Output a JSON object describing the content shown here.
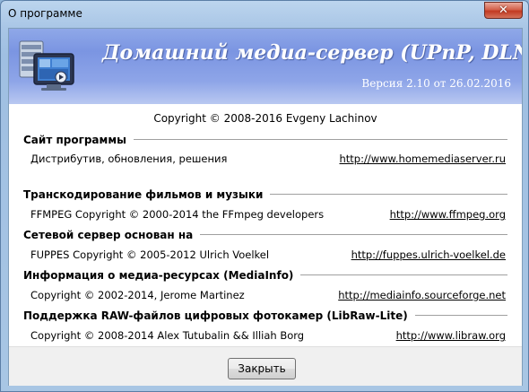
{
  "window": {
    "title": "О программе",
    "close_glyph": "✕"
  },
  "banner": {
    "title": "Домашний медиа-сервер (UPnP, DLNA,",
    "version": "Версия 2.10 от 26.02.2016"
  },
  "copyright": "Copyright © 2008-2016 Evgeny Lachinov",
  "sections": [
    {
      "heading": "Сайт программы",
      "desc": "Дистрибутив, обновления, решения",
      "link": "http://www.homemediaserver.ru"
    },
    {
      "heading": "Транскодирование фильмов и музыки",
      "desc": "FFMPEG Copyright © 2000-2014 the FFmpeg developers",
      "link": "http://www.ffmpeg.org"
    },
    {
      "heading": "Сетевой сервер основан на",
      "desc": "FUPPES Copyright © 2005-2012 Ulrich Voelkel",
      "link": "http://fuppes.ulrich-voelkel.de"
    },
    {
      "heading": "Информация о медиа-ресурсах (MediaInfo)",
      "desc": "Copyright © 2002-2014, Jerome Martinez",
      "link": "http://mediainfo.sourceforge.net"
    },
    {
      "heading": "Поддержка RAW-файлов цифровых фотокамер (LibRaw-Lite)",
      "desc": "Copyright © 2008-2014 Alex Tutubalin && Illiah Borg",
      "link": "http://www.libraw.org"
    }
  ],
  "footer": {
    "close_label": "Закрыть"
  }
}
